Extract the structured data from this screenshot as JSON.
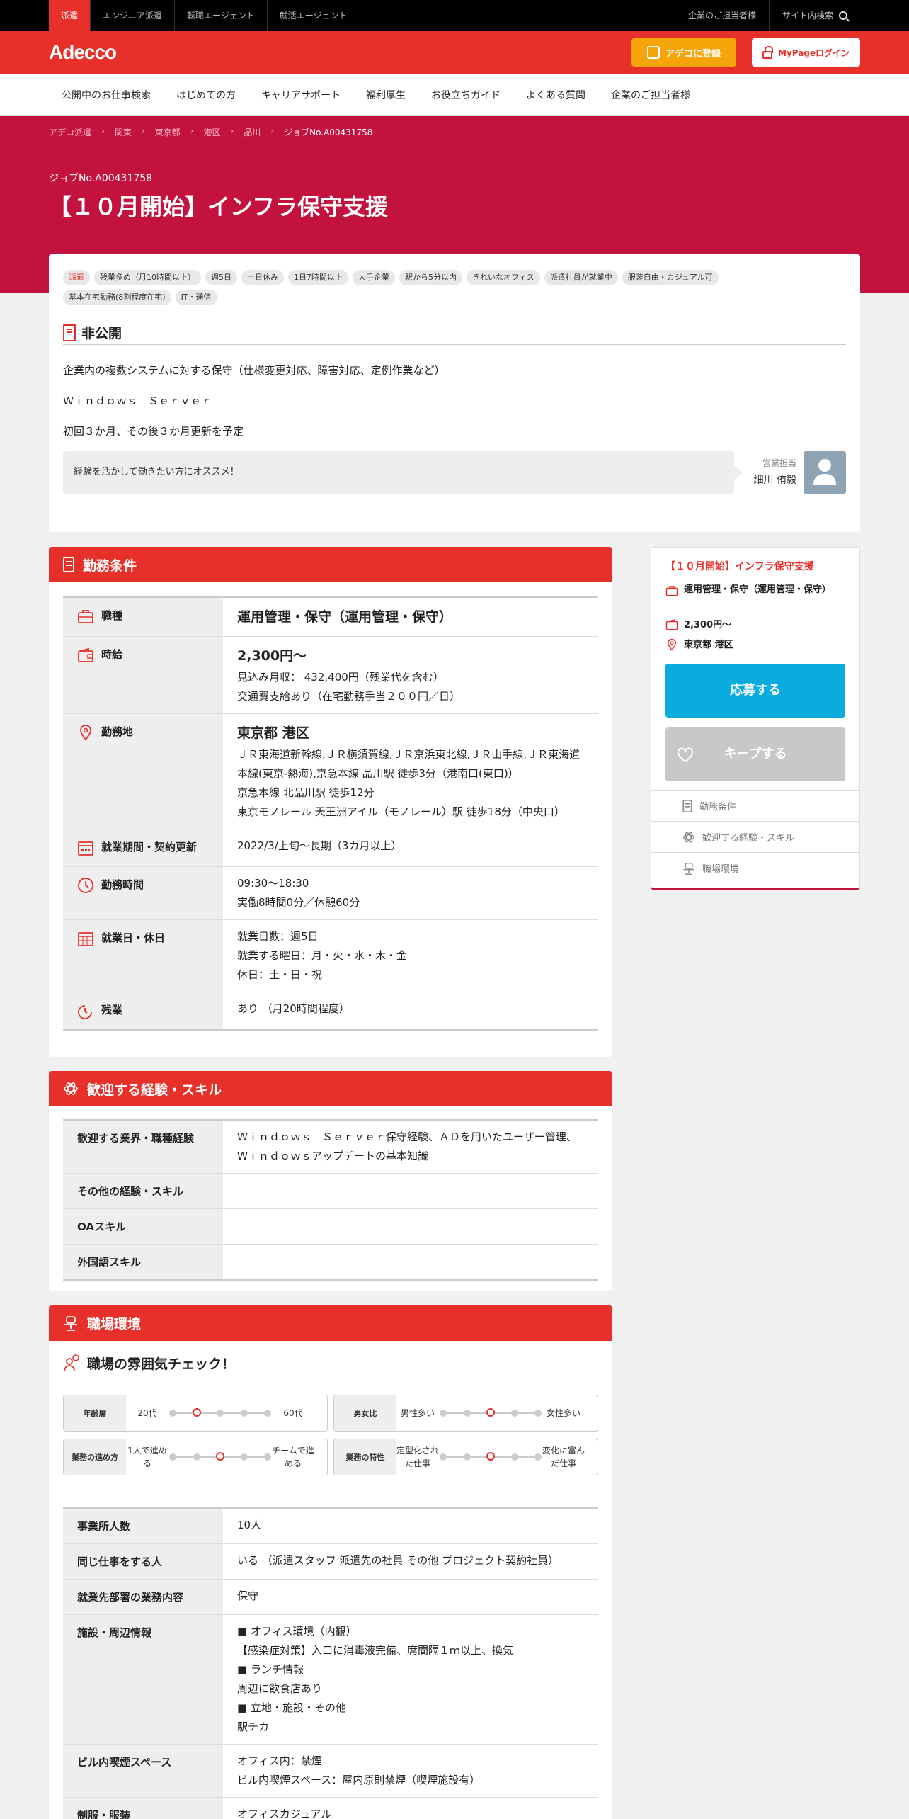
{
  "topbar": {
    "tabs": [
      "派遣",
      "エンジニア派遣",
      "転職エージェント",
      "就活エージェント"
    ],
    "right": [
      "企業のご担当者様",
      "サイト内検索"
    ]
  },
  "header": {
    "logo": "Adecco",
    "register": "アデコに登録",
    "login": "MyPageログイン"
  },
  "nav": [
    "公開中のお仕事検索",
    "はじめての方",
    "キャリアサポート",
    "福利厚生",
    "お役立ちガイド",
    "よくある質問",
    "企業のご担当者様"
  ],
  "breadcrumbs": [
    "アデコ派遣",
    "関東",
    "東京都",
    "港区",
    "品川",
    "ジョブNo.A00431758"
  ],
  "job": {
    "no": "ジョブNo.A00431758",
    "title": "【１０月開始】インフラ保守支援"
  },
  "tags": [
    "派遣",
    "残業多め（月10時間以上）",
    "週5日",
    "土日休み",
    "1日7時間以上",
    "大手企業",
    "駅から5分以内",
    "きれいなオフィス",
    "派遣社員が就業中",
    "服装自由・カジュアル可",
    "基本在宅勤務(8割程度在宅)",
    "IT・通信"
  ],
  "company": {
    "heading": "非公開",
    "desc1": "企業内の複数システムに対する保守（仕様変更対応、障害対応、定例作業など）",
    "desc2": "Ｗｉｎｄｏｗｓ　Ｓｅｒｖｅｒ",
    "desc3": "初回３か月、その後３か月更新を予定",
    "recommend": "経験を活かして働きたい方にオススメ！",
    "rep_label": "営業担当",
    "rep_name": "細川 侑毅"
  },
  "conditions": {
    "heading": "勤務条件",
    "job_k": "職種",
    "job_v": "運用管理・保守（運用管理・保守）",
    "wage_k": "時給",
    "wage_v": "2,300円～",
    "wage_v2": "見込み月収： 432,400円（残業代を含む）",
    "wage_v3": "交通費支給あり（在宅勤務手当２００円／日）",
    "loc_k": "勤務地",
    "loc_v": "東京都 港区",
    "loc_v2": "ＪＲ東海道新幹線,ＪＲ横須賀線,ＪＲ京浜東北線,ＪＲ山手線,ＪＲ東海道本線(東京-熱海),京急本線 品川駅 徒歩3分（港南口(東口)）",
    "loc_v3": "京急本線 北品川駅 徒歩12分",
    "loc_v4": "東京モノレール 天王洲アイル（モノレール）駅 徒歩18分（中央口）",
    "period_k": "就業期間・契約更新",
    "period_v": "2022/3/上旬～長期（3カ月以上）",
    "hours_k": "勤務時間",
    "hours_v": "09:30～18:30",
    "hours_v2": "実働8時間0分／休憩60分",
    "days_k": "就業日・休日",
    "days_v": "就業日数：週5日",
    "days_v2": "就業する曜日：月・火・水・木・金",
    "days_v3": "休日：土・日・祝",
    "ot_k": "残業",
    "ot_v": "あり （月20時間程度）"
  },
  "skills": {
    "heading": "歓迎する経験・スキル",
    "r1_k": "歓迎する業界・職種経験",
    "r1_v": "Ｗｉｎｄｏｗｓ　Ｓｅｒｖｅｒ保守経験、ＡＤを用いたユーザー管理、Ｗｉｎｄｏｗｓアップデートの基本知識",
    "r2_k": "その他の経験・スキル",
    "r3_k": "OAスキル",
    "r4_k": "外国語スキル"
  },
  "environment": {
    "heading": "職場環境",
    "atmos": "職場の雰囲気チェック！",
    "s1": {
      "label": "年齢層",
      "left": "20代",
      "right": "60代",
      "level": 0.25
    },
    "s2": {
      "label": "男女比",
      "left": "男性多い",
      "right": "女性多い",
      "level": 0.5
    },
    "s3": {
      "label": "業務の進め方",
      "left": "1人で進める",
      "right": "チームで進める",
      "level": 0.5
    },
    "s4": {
      "label": "業務の特性",
      "left": "定型化された仕事",
      "right": "変化に富んだ仕事",
      "level": 0.5
    },
    "e1_k": "事業所人数",
    "e1_v": "10人",
    "e2_k": "同じ仕事をする人",
    "e2_v": "いる （派遣スタッフ 派遣先の社員 その他 プロジェクト契約社員）",
    "e3_k": "就業先部署の業務内容",
    "e3_v": "保守",
    "e4_k": "施設・周辺情報",
    "e4_v": [
      "■ オフィス環境（内観）",
      "【感染症対策】入口に消毒液完備、席間隔１ｍ以上、換気",
      "■ ランチ情報",
      "周辺に飲食店あり",
      "■ 立地・施設・その他",
      "駅チカ"
    ],
    "e5_k": "ビル内喫煙スペース",
    "e5_v": "オフィス内：禁煙",
    "e5_v2": "ビル内喫煙スペース：屋内原則禁煙（喫煙施設有）",
    "e6_k": "制服・服装",
    "e6_v": "オフィスカジュアル"
  },
  "sidebar": {
    "title": "【１０月開始】インフラ保守支援",
    "job": "運用管理・保守（運用管理・保守）",
    "wage": "2,300円～",
    "loc": "東京都 港区",
    "apply": "応募する",
    "keep": "キープする",
    "nav": [
      "勤務条件",
      "歓迎する経験・スキル",
      "職場環境"
    ]
  },
  "colors": {
    "brand_red": "#e8302a",
    "hero": "#c4123f",
    "apply": "#0aace0",
    "register": "#f5a40a"
  }
}
